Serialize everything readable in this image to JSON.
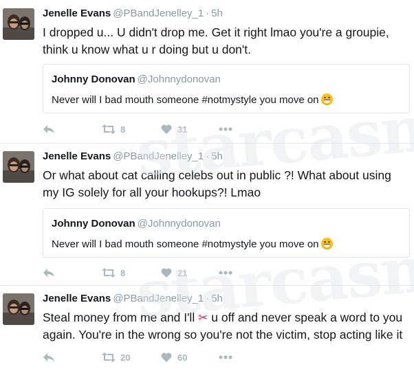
{
  "tweets": [
    {
      "author": {
        "name": "Jenelle Evans",
        "handle": "@PBandJenelley_1"
      },
      "separator": "·",
      "time": "5h",
      "text": "I dropped u... U didn't drop me. Get it right lmao you're a groupie, think u know what u r doing but u don't.",
      "quote": {
        "name": "Johnny Donovan",
        "handle": "@Johnnydonovan",
        "text": "Never will I bad mouth someone #notmystyle you move on"
      },
      "retweets": "8",
      "likes": "31"
    },
    {
      "author": {
        "name": "Jenelle Evans",
        "handle": "@PBandJenelley_1"
      },
      "separator": "·",
      "time": "5h",
      "text": "Or what about cat calling celebs out in public ?! What about using my IG solely for all your hookups?! Lmao",
      "quote": {
        "name": "Johnny Donovan",
        "handle": "@Johnnydonovan",
        "text": "Never will I bad mouth someone #notmystyle you move on"
      },
      "retweets": "8",
      "likes": "21"
    },
    {
      "author": {
        "name": "Jenelle Evans",
        "handle": "@PBandJenelley_1"
      },
      "separator": "·",
      "time": "5h",
      "text_before": "Steal money from me and I'll",
      "text_emoji": "✂",
      "text_after": "u off and never speak a word to you again. You're in the wrong so you're not the victim, stop acting like it",
      "retweets": "20",
      "likes": "60"
    }
  ],
  "icons": {
    "reply": "reply-icon",
    "retweet": "retweet-icon",
    "like": "heart-icon",
    "more": "more-icon",
    "emoji": "grinning-face-emoji",
    "scissors": "scissors-emoji"
  },
  "watermark": "starcasm",
  "colors": {
    "text": "#14171a",
    "secondary": "#8899a6",
    "action": "#aab8c2",
    "border": "#e1e8ed"
  }
}
